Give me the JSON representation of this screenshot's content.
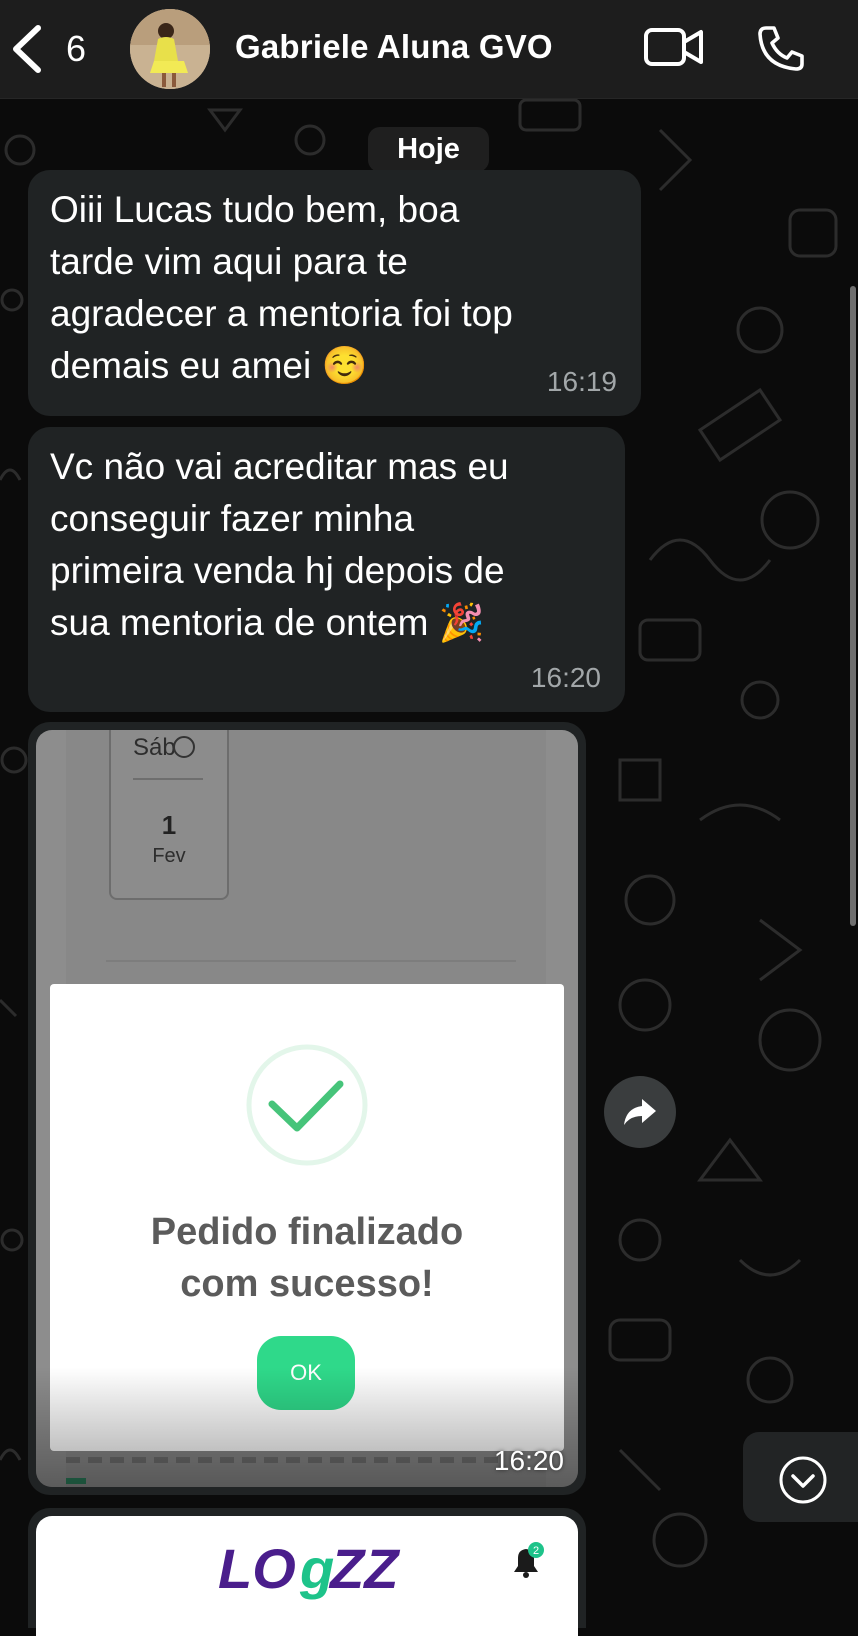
{
  "header": {
    "back_count": "6",
    "contact_name": "Gabriele Aluna GVO",
    "icons": [
      "chevron-left-icon",
      "video-call-icon",
      "phone-icon"
    ]
  },
  "date_chip": "Hoje",
  "messages": [
    {
      "text_lines": [
        "Oiii Lucas tudo bem, boa",
        "tarde vim aqui para te",
        "agradecer a mentoria foi top",
        "demais eu amei ☺️"
      ],
      "time": "16:19"
    },
    {
      "text_lines": [
        "Vc não vai acreditar mas eu",
        "conseguir fazer minha",
        "primeira venda hj depois de",
        "sua mentoria de ontem 🎉"
      ],
      "time": "16:20"
    }
  ],
  "image_message": {
    "time": "16:20",
    "screenshot": {
      "day_name": "Sáb",
      "day_number": "1",
      "day_month": "Fev",
      "modal_title_lines": [
        "Pedido finalizado",
        "com sucesso!"
      ],
      "ok_label": "OK"
    }
  },
  "second_image": {
    "logo_text": "LOGZZ",
    "bell_badge": "2"
  },
  "colors": {
    "bubble": "#202324",
    "header": "#1d1d1d",
    "success_green": "#2fd98a",
    "logo_purple": "#4a1e8c"
  }
}
